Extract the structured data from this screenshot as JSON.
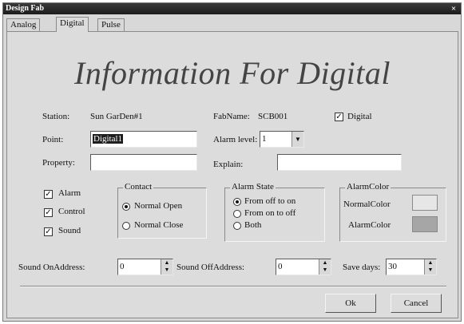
{
  "window": {
    "title": "Design Fab",
    "close_glyph": "×"
  },
  "tabs": [
    {
      "label": "Analog",
      "active": false
    },
    {
      "label": "Digital",
      "active": true
    },
    {
      "label": "Pulse",
      "active": false
    }
  ],
  "heading": "Information For Digital",
  "station": {
    "label": "Station:",
    "value": "Sun GarDen#1"
  },
  "fabname": {
    "label": "FabName:",
    "value": "SCB001"
  },
  "digital_check": {
    "label": "Digital",
    "checked": true
  },
  "point": {
    "label": "Point:",
    "value": "Digital1"
  },
  "alarm_level": {
    "label": "Alarm level:",
    "value": "1"
  },
  "property": {
    "label": "Property:",
    "value": ""
  },
  "explain": {
    "label": "Explain:",
    "value": ""
  },
  "options": [
    {
      "label": "Alarm",
      "checked": true
    },
    {
      "label": "Control",
      "checked": true
    },
    {
      "label": "Sound",
      "checked": true
    }
  ],
  "contact": {
    "title": "Contact",
    "items": [
      {
        "label": "Normal Open",
        "selected": true
      },
      {
        "label": "Normal Close",
        "selected": false
      }
    ]
  },
  "alarm_state": {
    "title": "Alarm State",
    "items": [
      {
        "label": "From off to on",
        "selected": true
      },
      {
        "label": "From on to off",
        "selected": false
      },
      {
        "label": "Both",
        "selected": false
      }
    ]
  },
  "alarm_color": {
    "title": "AlarmColor",
    "normal_label": "NormalColor",
    "alarm_label": "AlarmColor",
    "normal_color": "#e6e6e6",
    "alarm_color": "#a6a6a6"
  },
  "sound_on": {
    "label": "Sound OnAddress:",
    "value": "0"
  },
  "sound_off": {
    "label": "Sound OffAddress:",
    "value": "0"
  },
  "save_days": {
    "label": "Save days:",
    "value": "30"
  },
  "buttons": {
    "ok": "Ok",
    "cancel": "Cancel"
  }
}
